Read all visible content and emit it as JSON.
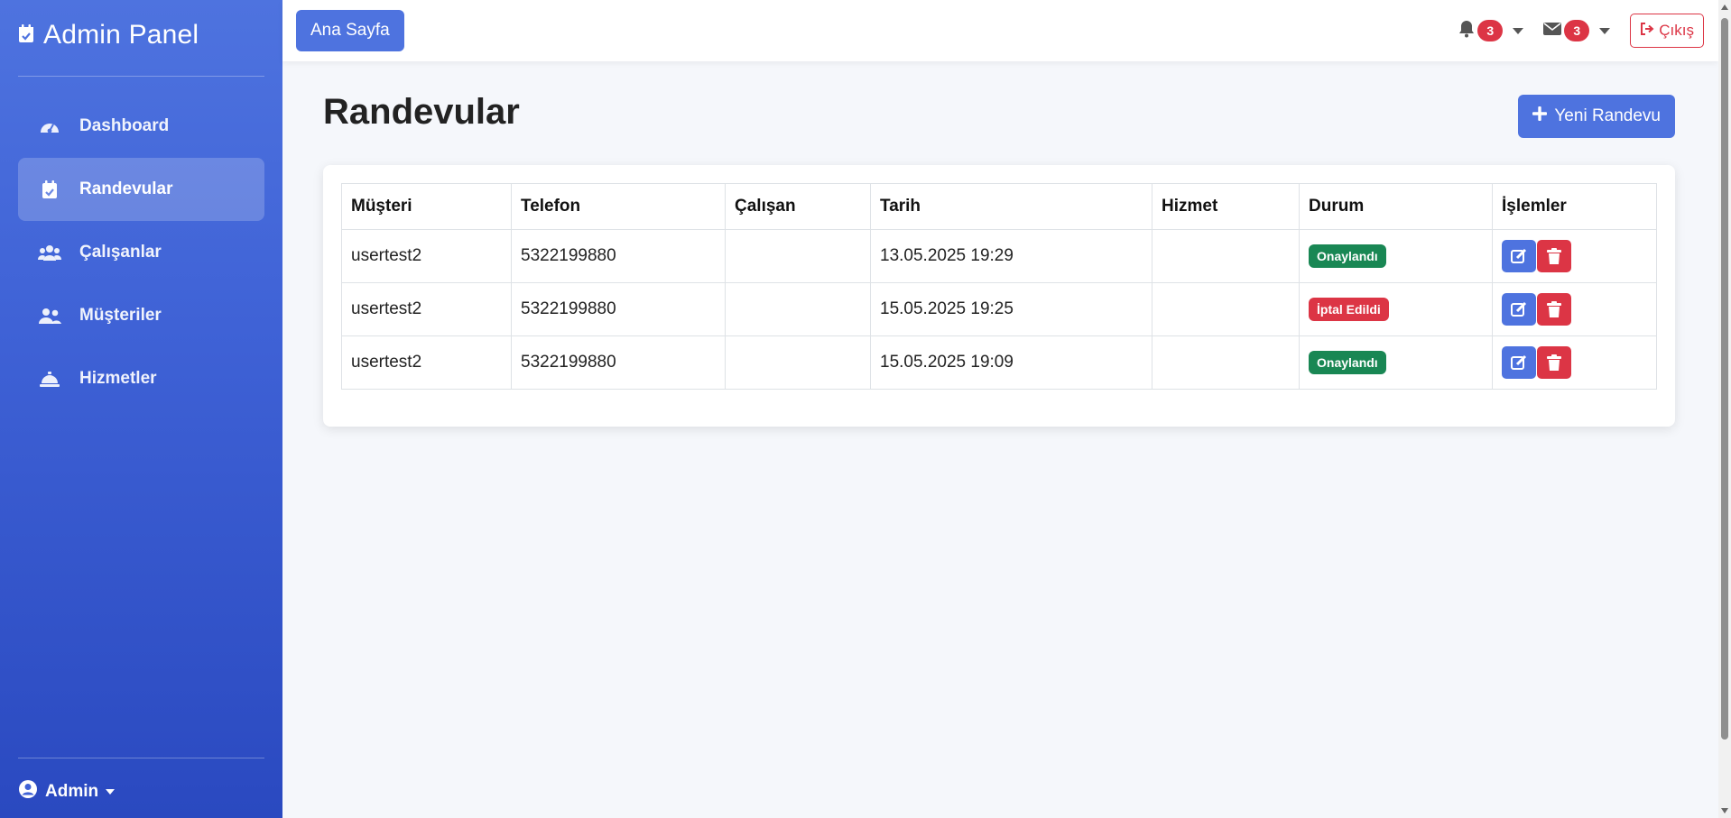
{
  "sidebar": {
    "brand": "Admin Panel",
    "items": [
      {
        "label": "Dashboard",
        "icon": "gauge-icon"
      },
      {
        "label": "Randevular",
        "icon": "calendar-check-icon",
        "active": true
      },
      {
        "label": "Çalışanlar",
        "icon": "users-icon"
      },
      {
        "label": "Müşteriler",
        "icon": "user-friends-icon"
      },
      {
        "label": "Hizmetler",
        "icon": "concierge-bell-icon"
      }
    ],
    "user": "Admin"
  },
  "topbar": {
    "home_label": "Ana Sayfa",
    "notifications_count": "3",
    "messages_count": "3",
    "logout_label": "Çıkış"
  },
  "page": {
    "title": "Randevular",
    "new_button": "Yeni Randevu"
  },
  "table": {
    "headers": [
      "Müşteri",
      "Telefon",
      "Çalışan",
      "Tarih",
      "Hizmet",
      "Durum",
      "İşlemler"
    ],
    "rows": [
      {
        "customer": "usertest2",
        "phone": "5322199880",
        "employee": "",
        "date": "13.05.2025 19:29",
        "service": "",
        "status": "Onaylandı"
      },
      {
        "customer": "usertest2",
        "phone": "5322199880",
        "employee": "",
        "date": "15.05.2025 19:25",
        "service": "",
        "status": "İptal Edildi"
      },
      {
        "customer": "usertest2",
        "phone": "5322199880",
        "employee": "",
        "date": "15.05.2025 19:09",
        "service": "",
        "status": "Onaylandı"
      }
    ]
  },
  "colors": {
    "primary": "#4e73df",
    "success": "#198754",
    "danger": "#dc3545"
  }
}
